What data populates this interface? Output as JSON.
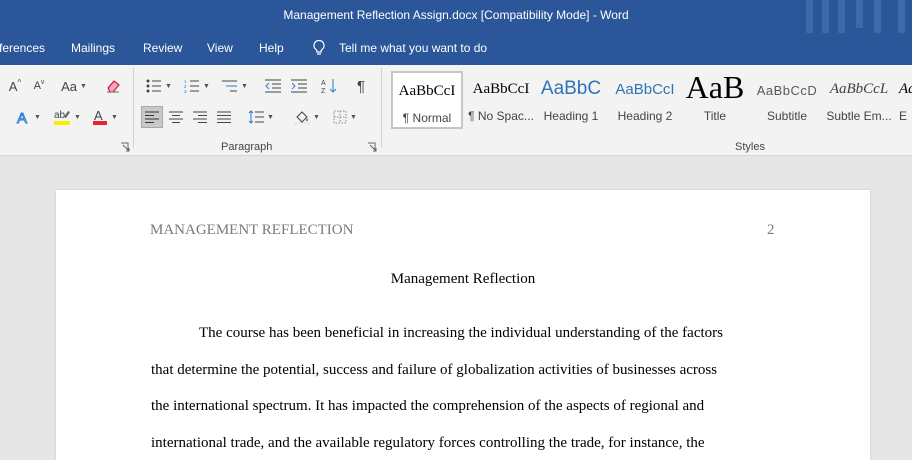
{
  "window": {
    "title": "Management Reflection Assign.docx [Compatibility Mode]  -  Word"
  },
  "tabs": [
    "ferences",
    "Mailings",
    "Review",
    "View",
    "Help"
  ],
  "tell_me": "Tell me what you want to do",
  "ribbon": {
    "groups": {
      "paragraph": "Paragraph",
      "styles": "Styles"
    },
    "font_buttons": {
      "change_case": "Aa"
    },
    "styles": [
      {
        "preview": "AaBbCcI",
        "name": "¶ Normal"
      },
      {
        "preview": "AaBbCcI",
        "name": "¶ No Spac..."
      },
      {
        "preview": "AaBbC",
        "name": "Heading 1"
      },
      {
        "preview": "AaBbCcI",
        "name": "Heading 2"
      },
      {
        "preview": "AaB",
        "name": "Title"
      },
      {
        "preview": "AaBbCcD",
        "name": "Subtitle"
      },
      {
        "preview": "AaBbCcL",
        "name": "Subtle Em..."
      },
      {
        "preview": "Aa",
        "name": "E"
      }
    ]
  },
  "document": {
    "header_title": "MANAGEMENT REFLECTION",
    "page_number": "2",
    "title": "Management Reflection",
    "lines": [
      "The course has been beneficial in increasing the individual understanding of the factors",
      "that determine the potential, success and failure of globalization activities of businesses across",
      "the international spectrum. It has impacted the comprehension of the aspects of regional and",
      "international trade, and the available regulatory forces controlling the trade, for instance, the"
    ]
  },
  "colors": {
    "accent": "#2b579a",
    "highlight": "#ffeb00",
    "font_color": "#e3262d",
    "heading": "#2e74b5"
  }
}
